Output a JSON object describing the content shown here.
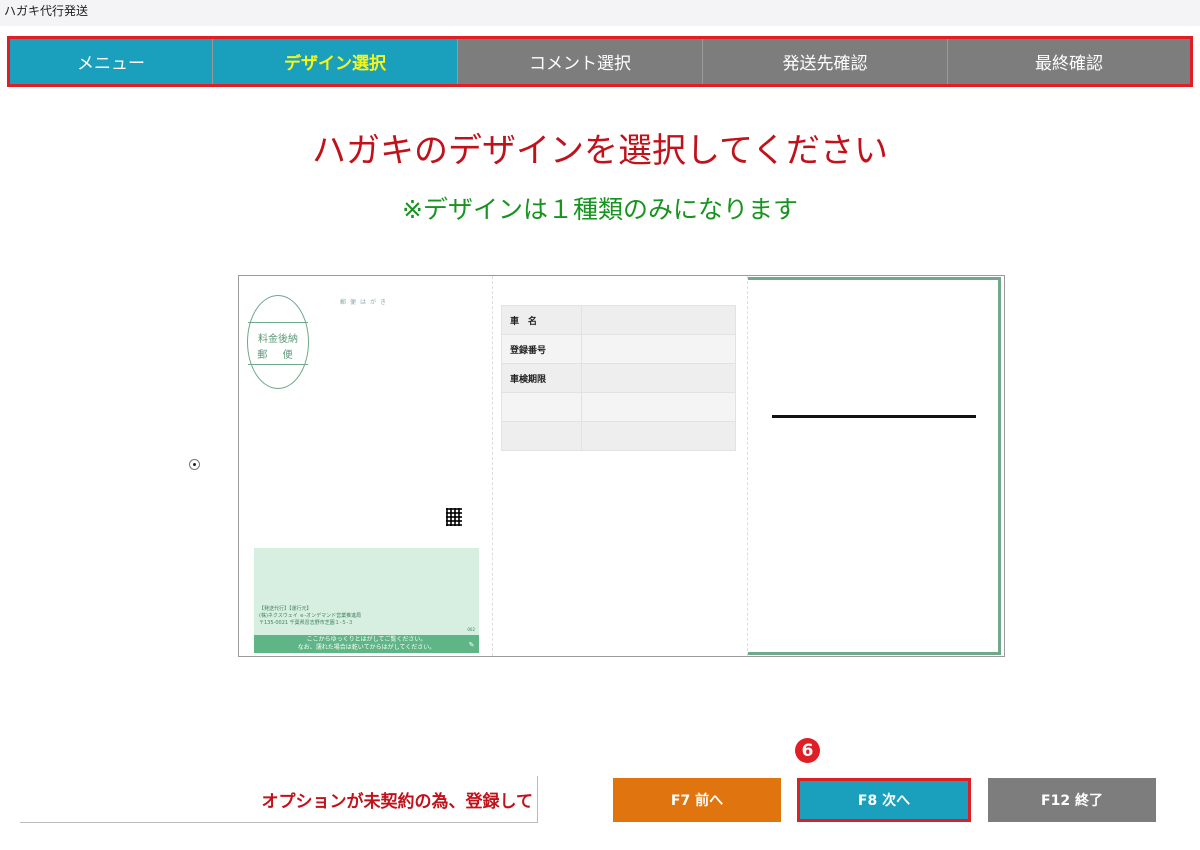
{
  "app": {
    "title": "ハガキ代行発送"
  },
  "steps": [
    {
      "label": "メニュー",
      "state": "done"
    },
    {
      "label": "デザイン選択",
      "state": "active"
    },
    {
      "label": "コメント選択",
      "state": "todo"
    },
    {
      "label": "発送先確認",
      "state": "todo"
    },
    {
      "label": "最終確認",
      "state": "todo"
    }
  ],
  "main": {
    "heading": "ハガキのデザインを選択してください",
    "subheading": "※デザインは１種類のみになります"
  },
  "design": {
    "selected": true,
    "postcard_label": "郵便はがき",
    "stamp_line1": "料金後納",
    "stamp_line2": "郵 便",
    "fields": [
      {
        "label": "車　名",
        "value": ""
      },
      {
        "label": "登録番号",
        "value": ""
      },
      {
        "label": "車検期限",
        "value": ""
      },
      {
        "label": "",
        "value": ""
      },
      {
        "label": "",
        "value": ""
      }
    ],
    "sender_text": "【発送代行】【運行元】\n(株)ネクスウェイ ｅ-オンデマンド営業推進局\n〒135-0021 千葉県習志野市芝園１-５-３",
    "peel_text_1": "ここからゆっくりとはがしてご覧ください。",
    "peel_text_2": "なお、濡れた場合は乾いてからはがしてください。",
    "number": "002"
  },
  "footer": {
    "status_text": "オプションが未契約の為、登録して",
    "prev_button": "F7 前へ",
    "next_button": "F8 次へ",
    "end_button": "F12 終了",
    "marker": "6"
  },
  "colors": {
    "active_step": "#1aa0bd",
    "inactive_step": "#7d7d7d",
    "highlight_border": "#e01e25",
    "heading": "#c0121a",
    "subheading": "#17931f",
    "prev_button": "#e07510"
  }
}
